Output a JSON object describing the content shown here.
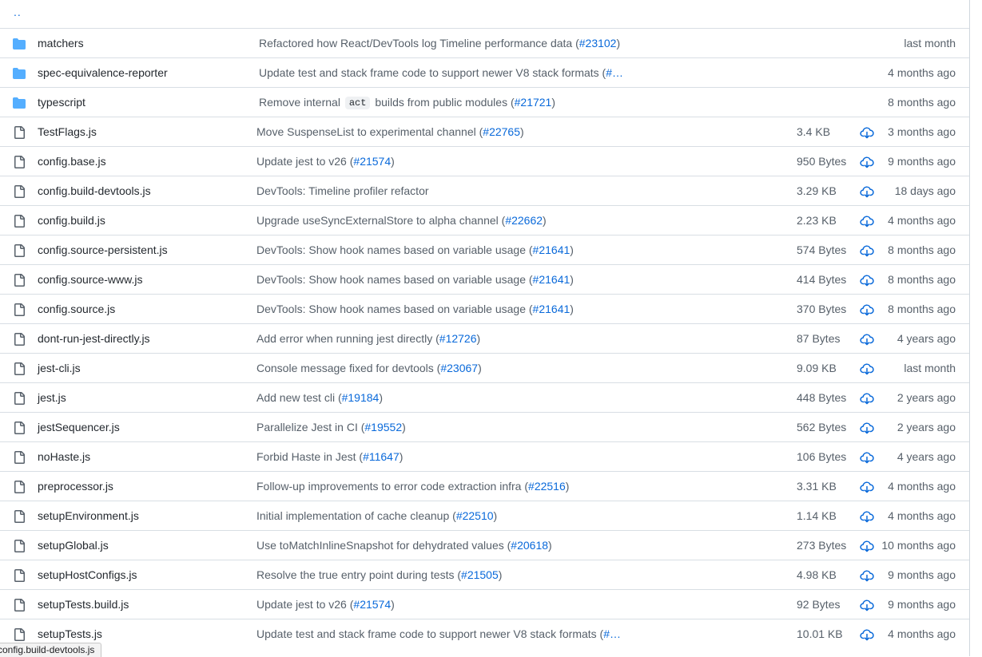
{
  "parent_link": "..",
  "directories": [
    {
      "name": "matchers",
      "message": "Refactored how React/DevTools log Timeline performance data (",
      "pr": "#23102",
      "suffix": ")",
      "age": "last month"
    },
    {
      "name": "spec-equivalence-reporter",
      "message": "Update test and stack frame code to support newer V8 stack formats (",
      "pr": "#…",
      "suffix": "",
      "age": "4 months ago"
    },
    {
      "name": "typescript",
      "message": "Remove internal ",
      "code": "act",
      "message2": " builds from public modules (",
      "pr": "#21721",
      "suffix": ")",
      "age": "8 months ago"
    }
  ],
  "files": [
    {
      "name": "TestFlags.js",
      "message": "Move SuspenseList to experimental channel (",
      "pr": "#22765",
      "suffix": ")",
      "size": "3.4 KB",
      "age": "3 months ago"
    },
    {
      "name": "config.base.js",
      "message": "Update jest to v26 (",
      "pr": "#21574",
      "suffix": ")",
      "size": "950 Bytes",
      "age": "9 months ago"
    },
    {
      "name": "config.build-devtools.js",
      "message": "DevTools: Timeline profiler refactor",
      "pr": "",
      "suffix": "",
      "size": "3.29 KB",
      "age": "18 days ago"
    },
    {
      "name": "config.build.js",
      "message": "Upgrade useSyncExternalStore to alpha channel (",
      "pr": "#22662",
      "suffix": ")",
      "size": "2.23 KB",
      "age": "4 months ago"
    },
    {
      "name": "config.source-persistent.js",
      "message": "DevTools: Show hook names based on variable usage (",
      "pr": "#21641",
      "suffix": ")",
      "size": "574 Bytes",
      "age": "8 months ago"
    },
    {
      "name": "config.source-www.js",
      "message": "DevTools: Show hook names based on variable usage (",
      "pr": "#21641",
      "suffix": ")",
      "size": "414 Bytes",
      "age": "8 months ago"
    },
    {
      "name": "config.source.js",
      "message": "DevTools: Show hook names based on variable usage (",
      "pr": "#21641",
      "suffix": ")",
      "size": "370 Bytes",
      "age": "8 months ago"
    },
    {
      "name": "dont-run-jest-directly.js",
      "message": "Add error when running jest directly (",
      "pr": "#12726",
      "suffix": ")",
      "size": "87 Bytes",
      "age": "4 years ago"
    },
    {
      "name": "jest-cli.js",
      "message": "Console message fixed for devtools (",
      "pr": "#23067",
      "suffix": ")",
      "size": "9.09 KB",
      "age": "last month"
    },
    {
      "name": "jest.js",
      "message": "Add new test cli (",
      "pr": "#19184",
      "suffix": ")",
      "size": "448 Bytes",
      "age": "2 years ago"
    },
    {
      "name": "jestSequencer.js",
      "message": "Parallelize Jest in CI (",
      "pr": "#19552",
      "suffix": ")",
      "size": "562 Bytes",
      "age": "2 years ago"
    },
    {
      "name": "noHaste.js",
      "message": "Forbid Haste in Jest (",
      "pr": "#11647",
      "suffix": ")",
      "size": "106 Bytes",
      "age": "4 years ago"
    },
    {
      "name": "preprocessor.js",
      "message": "Follow-up improvements to error code extraction infra (",
      "pr": "#22516",
      "suffix": ")",
      "size": "3.31 KB",
      "age": "4 months ago"
    },
    {
      "name": "setupEnvironment.js",
      "message": "Initial implementation of cache cleanup (",
      "pr": "#22510",
      "suffix": ")",
      "size": "1.14 KB",
      "age": "4 months ago"
    },
    {
      "name": "setupGlobal.js",
      "message": "Use toMatchInlineSnapshot for dehydrated values (",
      "pr": "#20618",
      "suffix": ")",
      "size": "273 Bytes",
      "age": "10 months ago"
    },
    {
      "name": "setupHostConfigs.js",
      "message": "Resolve the true entry point during tests (",
      "pr": "#21505",
      "suffix": ")",
      "size": "4.98 KB",
      "age": "9 months ago"
    },
    {
      "name": "setupTests.build.js",
      "message": "Update jest to v26 (",
      "pr": "#21574",
      "suffix": ")",
      "size": "92 Bytes",
      "age": "9 months ago"
    },
    {
      "name": "setupTests.js",
      "message": "Update test and stack frame code to support newer V8 stack formats (",
      "pr": "#…",
      "suffix": "",
      "size": "10.01 KB",
      "age": "4 months ago"
    }
  ],
  "status_bar": "config.build-devtools.js",
  "colors": {
    "folder": "#54aeff",
    "link": "#0969da",
    "muted": "#57606a",
    "file_icon": "#57606a"
  }
}
